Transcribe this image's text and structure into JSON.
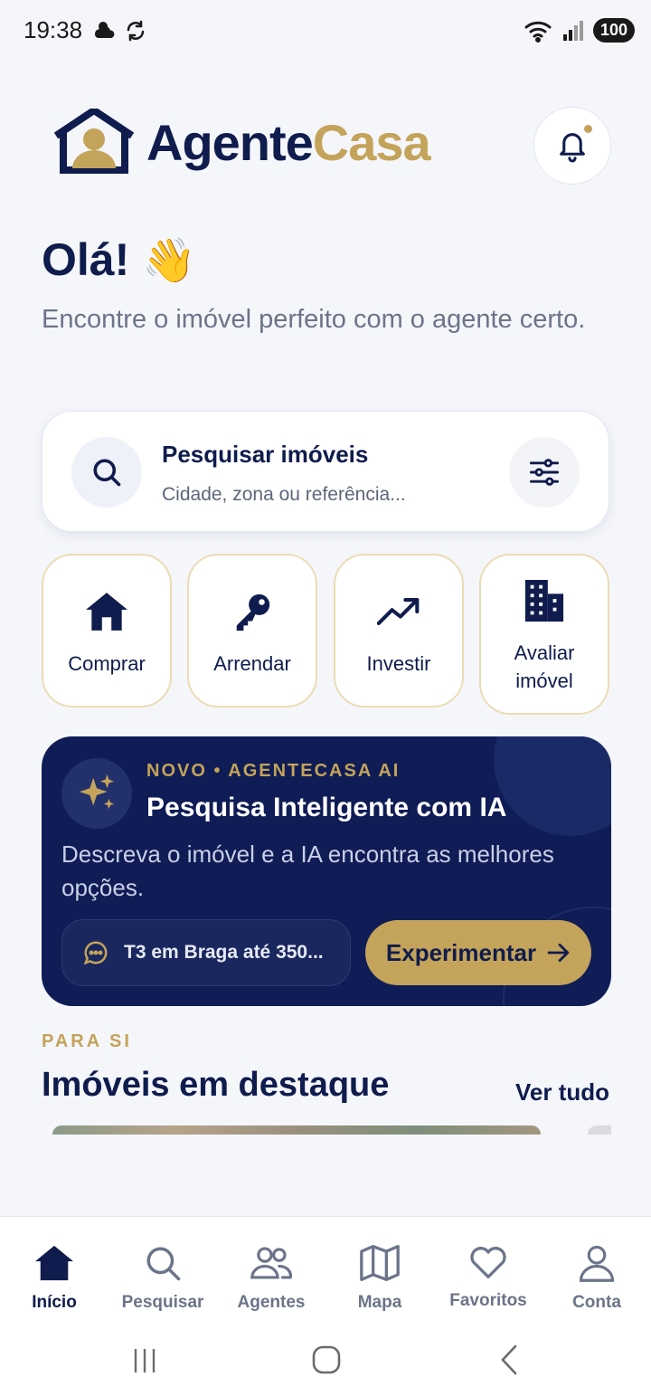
{
  "status_bar": {
    "time": "19:38",
    "battery": "100"
  },
  "brand": {
    "name_part1": "Agente",
    "name_part2": "Casa"
  },
  "greeting": {
    "title": "Olá!",
    "emoji": "👋",
    "subtitle": "Encontre o imóvel perfeito com o agente certo."
  },
  "search": {
    "title": "Pesquisar imóveis",
    "placeholder": "Cidade, zona ou referência..."
  },
  "quick_actions": [
    {
      "label": "Comprar",
      "icon": "house-icon"
    },
    {
      "label": "Arrendar",
      "icon": "key-icon"
    },
    {
      "label": "Investir",
      "icon": "trending-up-icon"
    },
    {
      "label": "Avaliar imóvel",
      "icon": "building-icon"
    }
  ],
  "ai_card": {
    "kicker": "NOVO • AGENTECASA AI",
    "title": "Pesquisa Inteligente com IA",
    "description": "Descreva o imóvel e a IA encontra as melhores opções.",
    "prompt_example": "T3 em Braga até 350...",
    "cta": "Experimentar"
  },
  "featured": {
    "kicker": "PARA SI",
    "title": "Imóveis em destaque",
    "see_all": "Ver tudo"
  },
  "bottom_nav": [
    {
      "label": "Início",
      "icon": "home-icon",
      "active": true
    },
    {
      "label": "Pesquisar",
      "icon": "search-icon",
      "active": false
    },
    {
      "label": "Agentes",
      "icon": "users-icon",
      "active": false
    },
    {
      "label": "Mapa",
      "icon": "map-icon",
      "active": false
    },
    {
      "label": "Favoritos",
      "icon": "heart-icon",
      "active": false
    },
    {
      "label": "Conta",
      "icon": "user-icon",
      "active": false
    }
  ],
  "colors": {
    "navy": "#0f1c55",
    "gold": "#c4a35a",
    "background": "#f4f6fa"
  }
}
